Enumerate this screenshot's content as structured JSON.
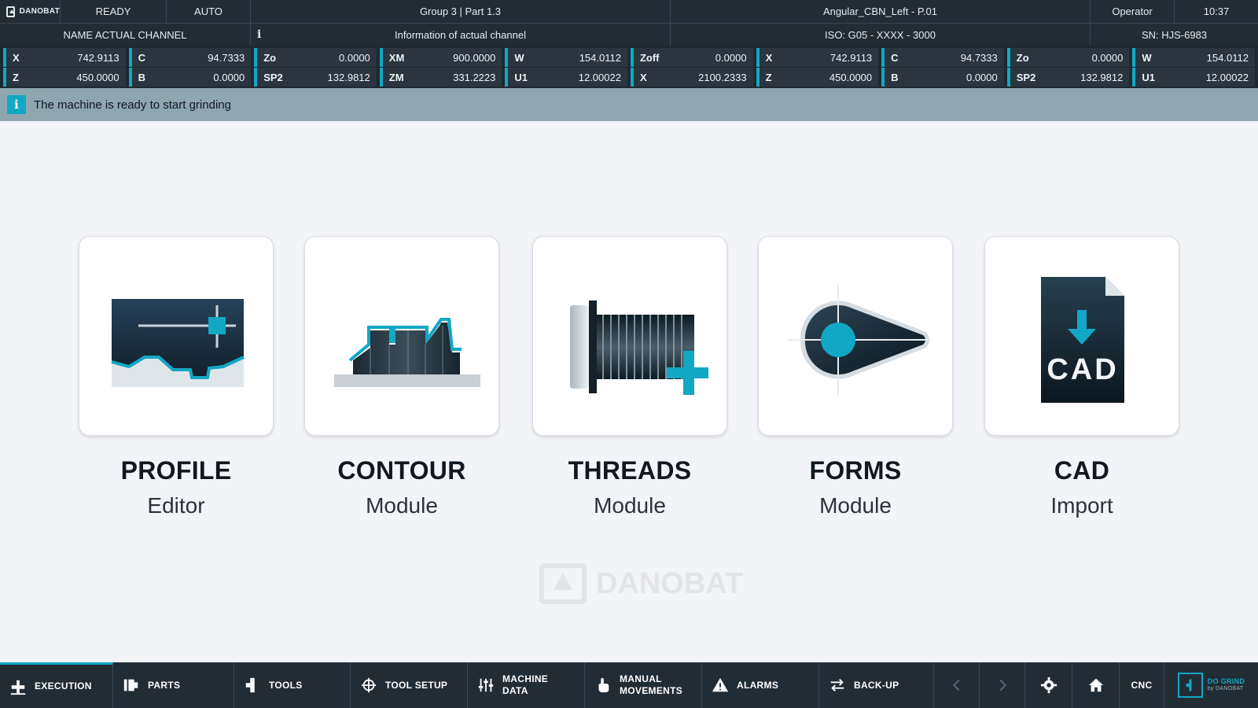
{
  "header": {
    "brand": "DANOBAT",
    "status": "READY",
    "mode": "AUTO",
    "group_part": "Group 3 | Part 1.3",
    "program": "Angular_CBN_Left - P.01",
    "user_role": "Operator",
    "time": "10:37",
    "channel_name": "NAME ACTUAL CHANNEL",
    "channel_info": "Information of actual channel",
    "iso_code": "ISO: G05 - XXXX - 3000",
    "serial": "SN: HJS-6983"
  },
  "axes": {
    "row1": [
      {
        "name": "X",
        "value": "742.9113"
      },
      {
        "name": "C",
        "value": "94.7333"
      },
      {
        "name": "Zo",
        "value": "0.0000"
      },
      {
        "name": "XM",
        "value": "900.0000"
      },
      {
        "name": "W",
        "value": "154.0112"
      },
      {
        "name": "Zoff",
        "value": "0.0000"
      },
      {
        "name": "X",
        "value": "742.9113"
      },
      {
        "name": "C",
        "value": "94.7333"
      },
      {
        "name": "Zo",
        "value": "0.0000"
      },
      {
        "name": "W",
        "value": "154.0112"
      }
    ],
    "row2": [
      {
        "name": "Z",
        "value": "450.0000"
      },
      {
        "name": "B",
        "value": "0.0000"
      },
      {
        "name": "SP2",
        "value": "132.9812"
      },
      {
        "name": "ZM",
        "value": "331.2223"
      },
      {
        "name": "U1",
        "value": "12.00022"
      },
      {
        "name": "X",
        "value": "2100.2333"
      },
      {
        "name": "Z",
        "value": "450.0000"
      },
      {
        "name": "B",
        "value": "0.0000"
      },
      {
        "name": "SP2",
        "value": "132.9812"
      },
      {
        "name": "U1",
        "value": "12.00022"
      }
    ]
  },
  "message": {
    "icon": "info-icon",
    "text": "The machine is ready to start grinding"
  },
  "modules": [
    {
      "title": "PROFILE",
      "subtitle": "Editor",
      "icon": "profile-editor-icon"
    },
    {
      "title": "CONTOUR",
      "subtitle": "Module",
      "icon": "contour-module-icon"
    },
    {
      "title": "THREADS",
      "subtitle": "Module",
      "icon": "threads-module-icon"
    },
    {
      "title": "FORMS",
      "subtitle": "Module",
      "icon": "forms-module-icon"
    },
    {
      "title": "CAD",
      "subtitle": "Import",
      "icon": "cad-import-icon",
      "icon_text": "CAD"
    }
  ],
  "watermark": "DANOBAT",
  "nav": {
    "execution": "EXECUTION",
    "parts": "PARTS",
    "tools": "TOOLS",
    "tool_setup": "TOOL SETUP",
    "machine_data": "MACHINE DATA",
    "manual_movements": "MANUAL MOVEMENTS",
    "alarms": "ALARMS",
    "backup": "BACK-UP",
    "cnc": "CNC",
    "brand_line1": "DO GRIND",
    "brand_line2": "by DANOBAT"
  },
  "colors": {
    "accent": "#12a7c5",
    "top_bar": "#222c35",
    "message_bar": "#8ea6b0",
    "background": "#f3f4f8"
  }
}
